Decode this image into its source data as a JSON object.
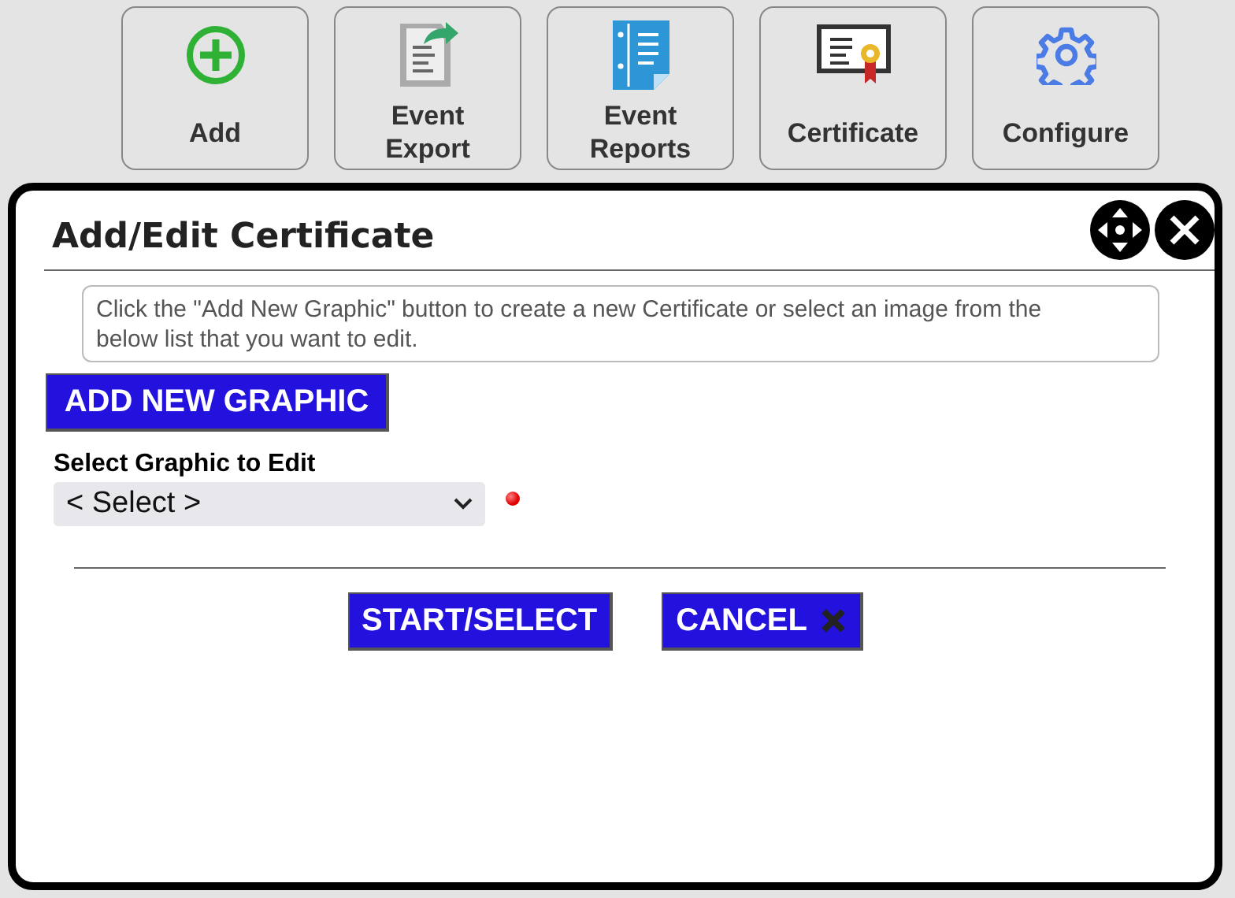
{
  "toolbar": [
    {
      "kind": "add",
      "label": "Add"
    },
    {
      "kind": "export",
      "label": "Event Export"
    },
    {
      "kind": "reports",
      "label": "Event Reports"
    },
    {
      "kind": "certificate",
      "label": "Certificate"
    },
    {
      "kind": "configure",
      "label": "Configure"
    }
  ],
  "dialog": {
    "title": "Add/Edit Certificate",
    "instructions": "Click the \"Add New Graphic\" button to create a new Certificate or select an image from the below list that you want to edit.",
    "add_button": "ADD NEW GRAPHIC",
    "select_label": "Select Graphic to Edit",
    "select": {
      "value": "< Select >",
      "required": true
    },
    "buttons": [
      {
        "kind": "primary",
        "label": "START/SELECT"
      },
      {
        "kind": "cancel",
        "label": "CANCEL"
      }
    ]
  }
}
